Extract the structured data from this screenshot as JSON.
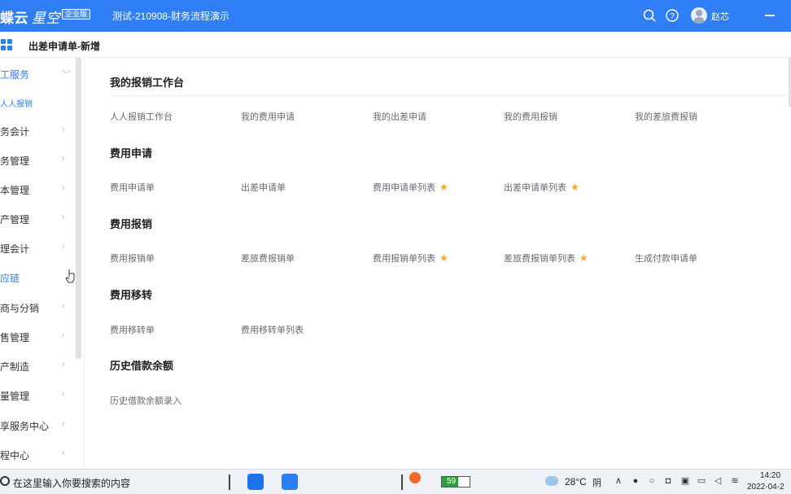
{
  "topbar": {
    "brand_main": "蝶云",
    "brand_sub": "星空",
    "edition_badge": "企业版",
    "app_title": "测试-210908-财务流程演示",
    "user_name": "赵芯",
    "icons": [
      "search-icon",
      "help-icon",
      "avatar",
      "minimize-icon"
    ],
    "color": "#2f7ef5"
  },
  "subheader": {
    "tab_title": "出差申请单-新增"
  },
  "sidebar": {
    "items": [
      {
        "label": "工服务",
        "state": "active-expanded"
      },
      {
        "label": "人人报销",
        "state": "sub-selected"
      },
      {
        "label": "务会计"
      },
      {
        "label": "务管理"
      },
      {
        "label": "本管理"
      },
      {
        "label": "产管理"
      },
      {
        "label": "理会计"
      },
      {
        "label": "应链",
        "state": "hover"
      },
      {
        "label": "商与分销"
      },
      {
        "label": "售管理"
      },
      {
        "label": "产制造"
      },
      {
        "label": "量管理"
      },
      {
        "label": "享服务中心"
      },
      {
        "label": "程中心"
      }
    ]
  },
  "main": {
    "sections": [
      {
        "title": "我的报销工作台",
        "links": [
          {
            "label": "人人报销工作台"
          },
          {
            "label": "我的费用申请"
          },
          {
            "label": "我的出差申请"
          },
          {
            "label": "我的费用报销"
          },
          {
            "label": "我的差旅费报销"
          }
        ]
      },
      {
        "title": "费用申请",
        "links": [
          {
            "label": "费用申请单"
          },
          {
            "label": "出差申请单"
          },
          {
            "label": "费用申请单列表",
            "starred": true
          },
          {
            "label": "出差申请单列表",
            "starred": true
          }
        ]
      },
      {
        "title": "费用报销",
        "links": [
          {
            "label": "费用报销单"
          },
          {
            "label": "差旅费报销单"
          },
          {
            "label": "费用报销单列表",
            "starred": true
          },
          {
            "label": "差旅费报销单列表",
            "starred": true
          },
          {
            "label": "生成付款申请单"
          }
        ]
      },
      {
        "title": "费用移转",
        "links": [
          {
            "label": "费用移转单"
          },
          {
            "label": "费用移转单列表"
          }
        ]
      },
      {
        "title": "历史借款余额",
        "links": [
          {
            "label": "历史借款余额录入"
          }
        ]
      }
    ],
    "star_color": "#f5a623"
  },
  "taskbar": {
    "search_placeholder": "在这里输入你要搜索的内容",
    "battery_percent": "59",
    "weather_temp": "28°C",
    "weather_desc": "阴",
    "time": "14:20",
    "date": "2022-04-2"
  }
}
